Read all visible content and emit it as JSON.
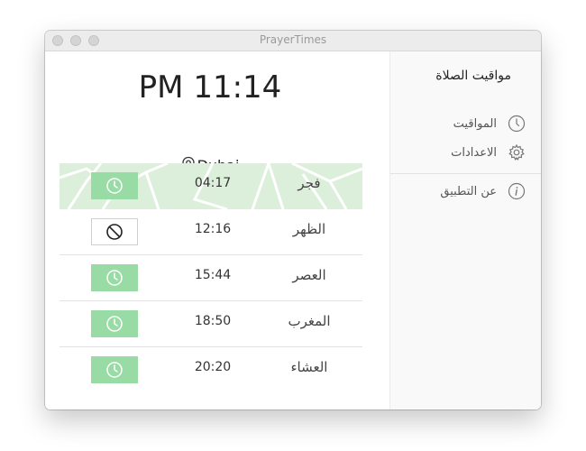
{
  "window": {
    "title": "PrayerTimes"
  },
  "main": {
    "current_time": "PM 11:14",
    "location": "Dubai",
    "prayers": [
      {
        "name": "فجر",
        "time": "04:17",
        "alarm": "on",
        "active": true
      },
      {
        "name": "الظهر",
        "time": "12:16",
        "alarm": "off",
        "active": false
      },
      {
        "name": "العصر",
        "time": "15:44",
        "alarm": "on",
        "active": false
      },
      {
        "name": "المغرب",
        "time": "18:50",
        "alarm": "on",
        "active": false
      },
      {
        "name": "العشاء",
        "time": "20:20",
        "alarm": "on",
        "active": false
      }
    ]
  },
  "sidebar": {
    "title": "مواقيت الصلاة",
    "items": [
      {
        "label": "المواقيت",
        "icon": "clock-icon"
      },
      {
        "label": "الاعدادات",
        "icon": "gear-icon"
      },
      {
        "label": "عن التطبيق",
        "icon": "info-icon"
      }
    ]
  },
  "colors": {
    "active_row": "#dcefdb",
    "alarm_on": "#98dba4",
    "pattern": "#ffffff"
  }
}
